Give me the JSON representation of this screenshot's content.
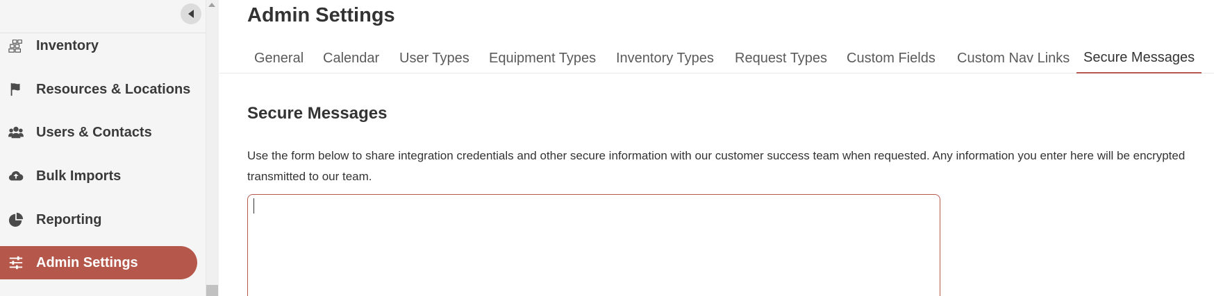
{
  "sidebar": {
    "items": [
      {
        "label": "Inventory",
        "icon": "boxes-icon"
      },
      {
        "label": "Resources & Locations",
        "icon": "flag-icon"
      },
      {
        "label": "Users & Contacts",
        "icon": "users-icon"
      },
      {
        "label": "Bulk Imports",
        "icon": "cloud-upload-icon"
      },
      {
        "label": "Reporting",
        "icon": "pie-chart-icon"
      },
      {
        "label": "Admin Settings",
        "icon": "sliders-icon",
        "active": true
      }
    ]
  },
  "header": {
    "title": "Admin Settings"
  },
  "tabs": [
    {
      "label": "General"
    },
    {
      "label": "Calendar"
    },
    {
      "label": "User Types"
    },
    {
      "label": "Equipment Types"
    },
    {
      "label": "Inventory Types"
    },
    {
      "label": "Request Types"
    },
    {
      "label": "Custom Fields"
    },
    {
      "label": "Custom Nav Links"
    },
    {
      "label": "Secure Messages",
      "active": true
    }
  ],
  "section": {
    "title": "Secure Messages",
    "description_line1": "Use the form below to share integration credentials and other secure information with our customer success team when requested. Any information you enter here will be encrypted",
    "description_line2": "transmitted to our team.",
    "message_value": ""
  },
  "colors": {
    "accent": "#b5584b",
    "sidebar_bg": "#f5f5f5",
    "text": "#333333"
  }
}
